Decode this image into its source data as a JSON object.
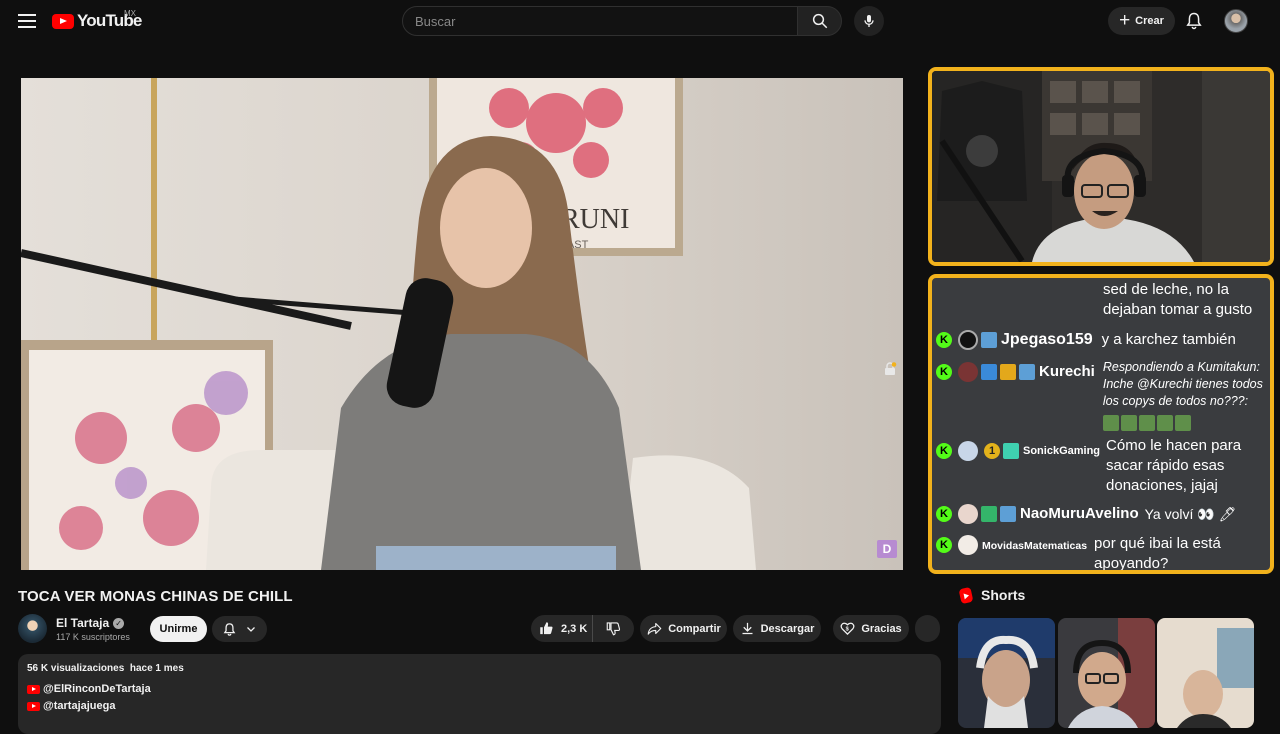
{
  "header": {
    "logo_text": "YouTube",
    "country_code": "MX",
    "search_placeholder": "Buscar",
    "create_label": "Crear"
  },
  "video": {
    "title": "TOCA VER MONAS CHINAS DE CHILL",
    "poster_text": "RUNI",
    "poster_subtext": "CAST",
    "badge_letter": "D"
  },
  "channel": {
    "name": "El Tartaja",
    "subscribers": "117 K suscriptores",
    "join_label": "Unirme"
  },
  "actions": {
    "likes": "2,3 K",
    "share_label": "Compartir",
    "download_label": "Descargar",
    "thanks_label": "Gracias"
  },
  "description": {
    "views": "56 K visualizaciones",
    "date": "hace 1 mes",
    "links": [
      "@ElRinconDeTartaja",
      "@tartajajuega"
    ]
  },
  "chat": {
    "messages": [
      {
        "user": "",
        "text": "sed de leche, no la dejaban tomar a gusto"
      },
      {
        "user": "Jpegaso159",
        "text": "y a karchez también"
      },
      {
        "user": "Kurechi",
        "text": "Respondiendo a Kumitakun: Inche @Kurechi tienes todos los copys de todos no???:"
      },
      {
        "user": "SonickGaming",
        "text": "Cómo le hacen para sacar rápido esas donaciones, jajaj",
        "badge": "1"
      },
      {
        "user": "NaoMuruAvelino",
        "text": "Ya volví 👀 🖊"
      },
      {
        "user": "MovidasMatematicas",
        "text": "por qué ibai la está apoyando?"
      }
    ]
  },
  "shorts": {
    "title": "Shorts"
  },
  "colors": {
    "accent_red": "#ff0000",
    "overlay_border": "#f2b21c",
    "kick_green": "#53fc18",
    "background": "#0f0f0f",
    "pill": "#272727"
  }
}
